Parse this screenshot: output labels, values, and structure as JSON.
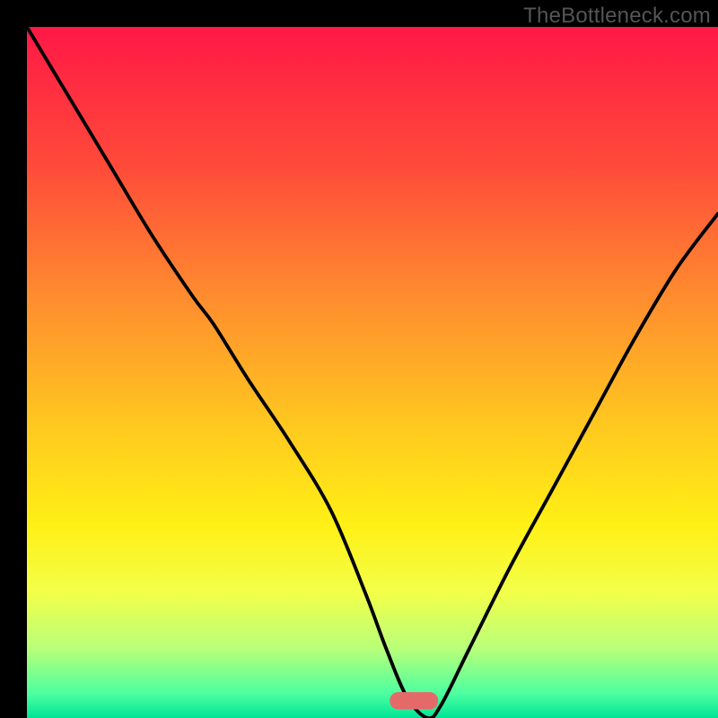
{
  "watermark": "TheBottleneck.com",
  "chart_data": {
    "type": "line",
    "title": "",
    "xlabel": "",
    "ylabel": "",
    "xlim": [
      0,
      100
    ],
    "ylim": [
      0,
      100
    ],
    "background_gradient_stops": [
      {
        "offset": 0.0,
        "color": "#ff1846"
      },
      {
        "offset": 0.2,
        "color": "#ff4a3a"
      },
      {
        "offset": 0.4,
        "color": "#ff8f2e"
      },
      {
        "offset": 0.58,
        "color": "#ffc91f"
      },
      {
        "offset": 0.72,
        "color": "#fff015"
      },
      {
        "offset": 0.82,
        "color": "#f2ff4a"
      },
      {
        "offset": 0.9,
        "color": "#b8ff7a"
      },
      {
        "offset": 0.965,
        "color": "#4cffa0"
      },
      {
        "offset": 1.0,
        "color": "#00e596"
      }
    ],
    "series": [
      {
        "name": "bottleneck-curve",
        "color": "#000000",
        "x": [
          0,
          6,
          12,
          18,
          24,
          27,
          32,
          38,
          44,
          49,
          52,
          55,
          58,
          60,
          64,
          70,
          76,
          82,
          88,
          94,
          100
        ],
        "values": [
          100,
          90,
          80,
          70,
          61,
          57,
          49,
          40,
          30,
          18,
          10,
          3,
          0,
          2,
          10,
          22,
          33,
          44,
          55,
          65,
          73
        ]
      }
    ],
    "marker": {
      "name": "sweet-spot-marker",
      "color": "#e46a6a",
      "x_center": 56,
      "y_center": 2.5,
      "width": 7,
      "height": 2.5
    }
  }
}
